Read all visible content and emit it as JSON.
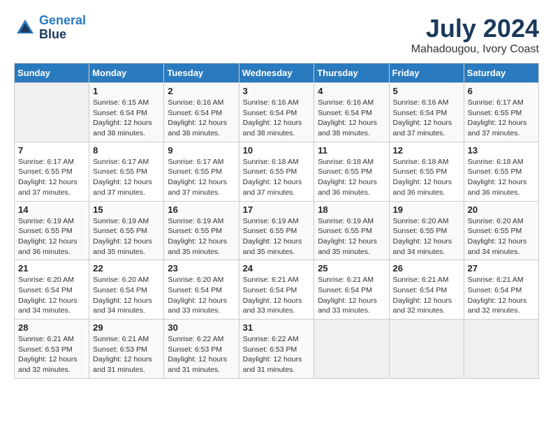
{
  "logo": {
    "line1": "General",
    "line2": "Blue"
  },
  "title": "July 2024",
  "location": "Mahadougou, Ivory Coast",
  "days_of_week": [
    "Sunday",
    "Monday",
    "Tuesday",
    "Wednesday",
    "Thursday",
    "Friday",
    "Saturday"
  ],
  "weeks": [
    [
      {
        "day": "",
        "sunrise": "",
        "sunset": "",
        "daylight": ""
      },
      {
        "day": "1",
        "sunrise": "Sunrise: 6:15 AM",
        "sunset": "Sunset: 6:54 PM",
        "daylight": "Daylight: 12 hours and 38 minutes."
      },
      {
        "day": "2",
        "sunrise": "Sunrise: 6:16 AM",
        "sunset": "Sunset: 6:54 PM",
        "daylight": "Daylight: 12 hours and 38 minutes."
      },
      {
        "day": "3",
        "sunrise": "Sunrise: 6:16 AM",
        "sunset": "Sunset: 6:54 PM",
        "daylight": "Daylight: 12 hours and 38 minutes."
      },
      {
        "day": "4",
        "sunrise": "Sunrise: 6:16 AM",
        "sunset": "Sunset: 6:54 PM",
        "daylight": "Daylight: 12 hours and 38 minutes."
      },
      {
        "day": "5",
        "sunrise": "Sunrise: 6:16 AM",
        "sunset": "Sunset: 6:54 PM",
        "daylight": "Daylight: 12 hours and 37 minutes."
      },
      {
        "day": "6",
        "sunrise": "Sunrise: 6:17 AM",
        "sunset": "Sunset: 6:55 PM",
        "daylight": "Daylight: 12 hours and 37 minutes."
      }
    ],
    [
      {
        "day": "7",
        "sunrise": "Sunrise: 6:17 AM",
        "sunset": "Sunset: 6:55 PM",
        "daylight": "Daylight: 12 hours and 37 minutes."
      },
      {
        "day": "8",
        "sunrise": "Sunrise: 6:17 AM",
        "sunset": "Sunset: 6:55 PM",
        "daylight": "Daylight: 12 hours and 37 minutes."
      },
      {
        "day": "9",
        "sunrise": "Sunrise: 6:17 AM",
        "sunset": "Sunset: 6:55 PM",
        "daylight": "Daylight: 12 hours and 37 minutes."
      },
      {
        "day": "10",
        "sunrise": "Sunrise: 6:18 AM",
        "sunset": "Sunset: 6:55 PM",
        "daylight": "Daylight: 12 hours and 37 minutes."
      },
      {
        "day": "11",
        "sunrise": "Sunrise: 6:18 AM",
        "sunset": "Sunset: 6:55 PM",
        "daylight": "Daylight: 12 hours and 36 minutes."
      },
      {
        "day": "12",
        "sunrise": "Sunrise: 6:18 AM",
        "sunset": "Sunset: 6:55 PM",
        "daylight": "Daylight: 12 hours and 36 minutes."
      },
      {
        "day": "13",
        "sunrise": "Sunrise: 6:18 AM",
        "sunset": "Sunset: 6:55 PM",
        "daylight": "Daylight: 12 hours and 36 minutes."
      }
    ],
    [
      {
        "day": "14",
        "sunrise": "Sunrise: 6:19 AM",
        "sunset": "Sunset: 6:55 PM",
        "daylight": "Daylight: 12 hours and 36 minutes."
      },
      {
        "day": "15",
        "sunrise": "Sunrise: 6:19 AM",
        "sunset": "Sunset: 6:55 PM",
        "daylight": "Daylight: 12 hours and 35 minutes."
      },
      {
        "day": "16",
        "sunrise": "Sunrise: 6:19 AM",
        "sunset": "Sunset: 6:55 PM",
        "daylight": "Daylight: 12 hours and 35 minutes."
      },
      {
        "day": "17",
        "sunrise": "Sunrise: 6:19 AM",
        "sunset": "Sunset: 6:55 PM",
        "daylight": "Daylight: 12 hours and 35 minutes."
      },
      {
        "day": "18",
        "sunrise": "Sunrise: 6:19 AM",
        "sunset": "Sunset: 6:55 PM",
        "daylight": "Daylight: 12 hours and 35 minutes."
      },
      {
        "day": "19",
        "sunrise": "Sunrise: 6:20 AM",
        "sunset": "Sunset: 6:55 PM",
        "daylight": "Daylight: 12 hours and 34 minutes."
      },
      {
        "day": "20",
        "sunrise": "Sunrise: 6:20 AM",
        "sunset": "Sunset: 6:55 PM",
        "daylight": "Daylight: 12 hours and 34 minutes."
      }
    ],
    [
      {
        "day": "21",
        "sunrise": "Sunrise: 6:20 AM",
        "sunset": "Sunset: 6:54 PM",
        "daylight": "Daylight: 12 hours and 34 minutes."
      },
      {
        "day": "22",
        "sunrise": "Sunrise: 6:20 AM",
        "sunset": "Sunset: 6:54 PM",
        "daylight": "Daylight: 12 hours and 34 minutes."
      },
      {
        "day": "23",
        "sunrise": "Sunrise: 6:20 AM",
        "sunset": "Sunset: 6:54 PM",
        "daylight": "Daylight: 12 hours and 33 minutes."
      },
      {
        "day": "24",
        "sunrise": "Sunrise: 6:21 AM",
        "sunset": "Sunset: 6:54 PM",
        "daylight": "Daylight: 12 hours and 33 minutes."
      },
      {
        "day": "25",
        "sunrise": "Sunrise: 6:21 AM",
        "sunset": "Sunset: 6:54 PM",
        "daylight": "Daylight: 12 hours and 33 minutes."
      },
      {
        "day": "26",
        "sunrise": "Sunrise: 6:21 AM",
        "sunset": "Sunset: 6:54 PM",
        "daylight": "Daylight: 12 hours and 32 minutes."
      },
      {
        "day": "27",
        "sunrise": "Sunrise: 6:21 AM",
        "sunset": "Sunset: 6:54 PM",
        "daylight": "Daylight: 12 hours and 32 minutes."
      }
    ],
    [
      {
        "day": "28",
        "sunrise": "Sunrise: 6:21 AM",
        "sunset": "Sunset: 6:53 PM",
        "daylight": "Daylight: 12 hours and 32 minutes."
      },
      {
        "day": "29",
        "sunrise": "Sunrise: 6:21 AM",
        "sunset": "Sunset: 6:53 PM",
        "daylight": "Daylight: 12 hours and 31 minutes."
      },
      {
        "day": "30",
        "sunrise": "Sunrise: 6:22 AM",
        "sunset": "Sunset: 6:53 PM",
        "daylight": "Daylight: 12 hours and 31 minutes."
      },
      {
        "day": "31",
        "sunrise": "Sunrise: 6:22 AM",
        "sunset": "Sunset: 6:53 PM",
        "daylight": "Daylight: 12 hours and 31 minutes."
      },
      {
        "day": "",
        "sunrise": "",
        "sunset": "",
        "daylight": ""
      },
      {
        "day": "",
        "sunrise": "",
        "sunset": "",
        "daylight": ""
      },
      {
        "day": "",
        "sunrise": "",
        "sunset": "",
        "daylight": ""
      }
    ]
  ]
}
